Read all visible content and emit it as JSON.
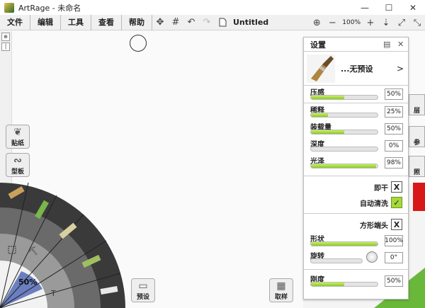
{
  "window": {
    "title": "ArtRage - 未命名",
    "controls": [
      "—",
      "☐",
      "✕"
    ]
  },
  "menu": {
    "items": [
      "文件",
      "编辑",
      "工具",
      "查看",
      "帮助"
    ]
  },
  "toolbar": {
    "doc_title": "Untitled",
    "zoom": "100%",
    "zoom_minus": "−",
    "zoom_plus": "+"
  },
  "side_buttons": {
    "sticker": "贴纸",
    "stencil": "型板",
    "presets": "预设",
    "sampler": "取样"
  },
  "right_tabs": [
    "层",
    "参",
    "照"
  ],
  "tool_wheel": {
    "zoom_pct": "50%"
  },
  "settings": {
    "title": "设置",
    "preset_name": "...无预设",
    "preset_arrow": ">",
    "sliders": [
      {
        "label": "压感",
        "value": "50%",
        "fill": 0.5
      },
      {
        "label": "稀释",
        "value": "25%",
        "fill": 0.25
      },
      {
        "label": "装载量",
        "value": "50%",
        "fill": 0.5
      },
      {
        "label": "深度",
        "value": "0%",
        "fill": 0.0
      },
      {
        "label": "光泽",
        "value": "98%",
        "fill": 0.98
      }
    ],
    "instant_dry": {
      "label": "即干",
      "mark": "X"
    },
    "auto_clean": {
      "label": "自动清洗",
      "mark": "✓"
    },
    "square_head": {
      "label": "方形端头",
      "mark": "X"
    },
    "shape": {
      "label": "形状",
      "value": "100%",
      "fill": 1.0
    },
    "rotation": {
      "label": "旋转",
      "value": "0°",
      "fill": 0.0
    },
    "stiffness": {
      "label": "刚度",
      "value": "50%",
      "fill": 0.5
    }
  },
  "colors": {
    "accent_fill": "#a6d83a",
    "canvas": "#fafafa"
  }
}
